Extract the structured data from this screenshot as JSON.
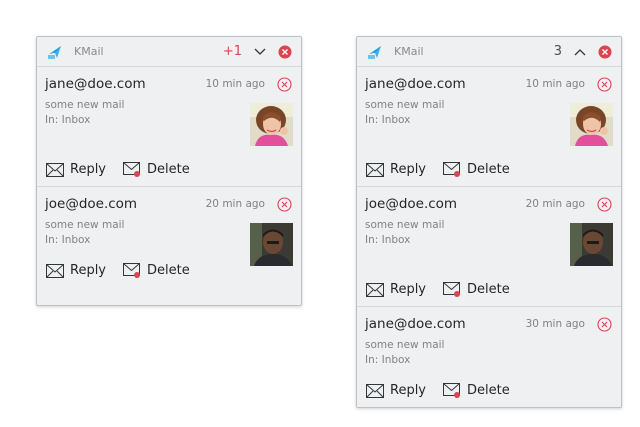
{
  "left_popup": {
    "app_name": "KMail",
    "count": "+1",
    "notifications": [
      {
        "title": "jane@doe.com",
        "time": "10 min ago",
        "body": "some new mail",
        "folder": "In: Inbox",
        "reply_label": "Reply",
        "delete_label": "Delete"
      },
      {
        "title": "joe@doe.com",
        "time": "20 min ago",
        "body": "some new mail",
        "folder": "In: Inbox",
        "reply_label": "Reply",
        "delete_label": "Delete"
      }
    ]
  },
  "right_popup": {
    "app_name": "KMail",
    "count": "3",
    "notifications": [
      {
        "title": "jane@doe.com",
        "time": "10 min ago",
        "body": "some new mail",
        "folder": "In: Inbox",
        "reply_label": "Reply",
        "delete_label": "Delete"
      },
      {
        "title": "joe@doe.com",
        "time": "20 min ago",
        "body": "some new mail",
        "folder": "In: Inbox",
        "reply_label": "Reply",
        "delete_label": "Delete"
      },
      {
        "title": "jane@doe.com",
        "time": "30 min ago",
        "body": "some new mail",
        "folder": "In: Inbox",
        "reply_label": "Reply",
        "delete_label": "Delete"
      }
    ]
  },
  "colors": {
    "close_red": "#da4453",
    "popup_bg": "#eff0f1",
    "kmail_blue": "#3daee9"
  }
}
